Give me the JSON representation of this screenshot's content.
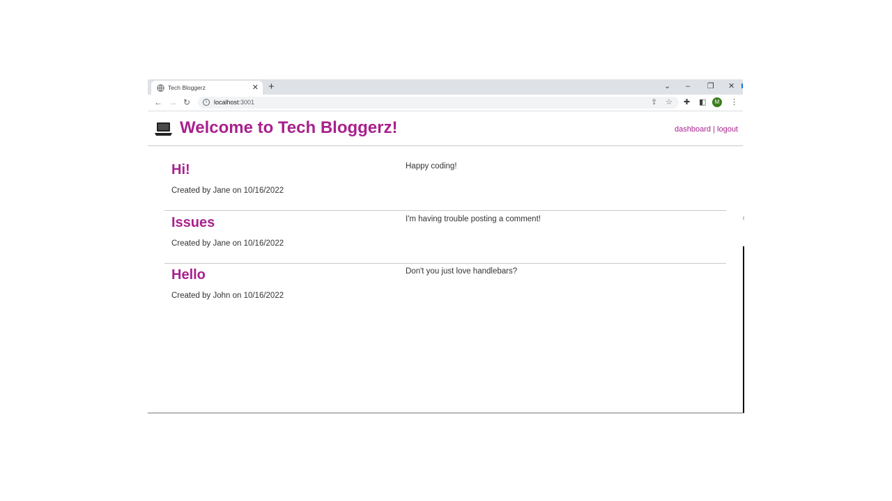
{
  "browser": {
    "tab_title": "Tech Bloggerz",
    "url_host": "localhost",
    "url_port": ":3001",
    "avatar_letter": "M"
  },
  "header": {
    "title": "Welcome to Tech Bloggerz!",
    "links": {
      "dashboard": "dashboard",
      "separator": "|",
      "logout": "logout"
    }
  },
  "posts": [
    {
      "title": "Hi!",
      "meta": "Created by Jane on 10/16/2022",
      "body": "Happy coding!"
    },
    {
      "title": "Issues",
      "meta": "Created by Jane on 10/16/2022",
      "body": "I'm having trouble posting a comment!"
    },
    {
      "title": "Hello",
      "meta": "Created by John on 10/16/2022",
      "body": "Don't you just love handlebars?"
    }
  ],
  "colors": {
    "accent": "#a8218e",
    "avatar": "#3a7d1c"
  },
  "icons": [
    "globe-icon",
    "close-icon",
    "plus-icon",
    "chevron-down-icon",
    "minimize-icon",
    "restore-icon",
    "back-icon",
    "forward-icon",
    "reload-icon",
    "info-icon",
    "share-icon",
    "star-icon",
    "extensions-icon",
    "side-panel-icon",
    "menu-icon",
    "laptop-icon"
  ]
}
